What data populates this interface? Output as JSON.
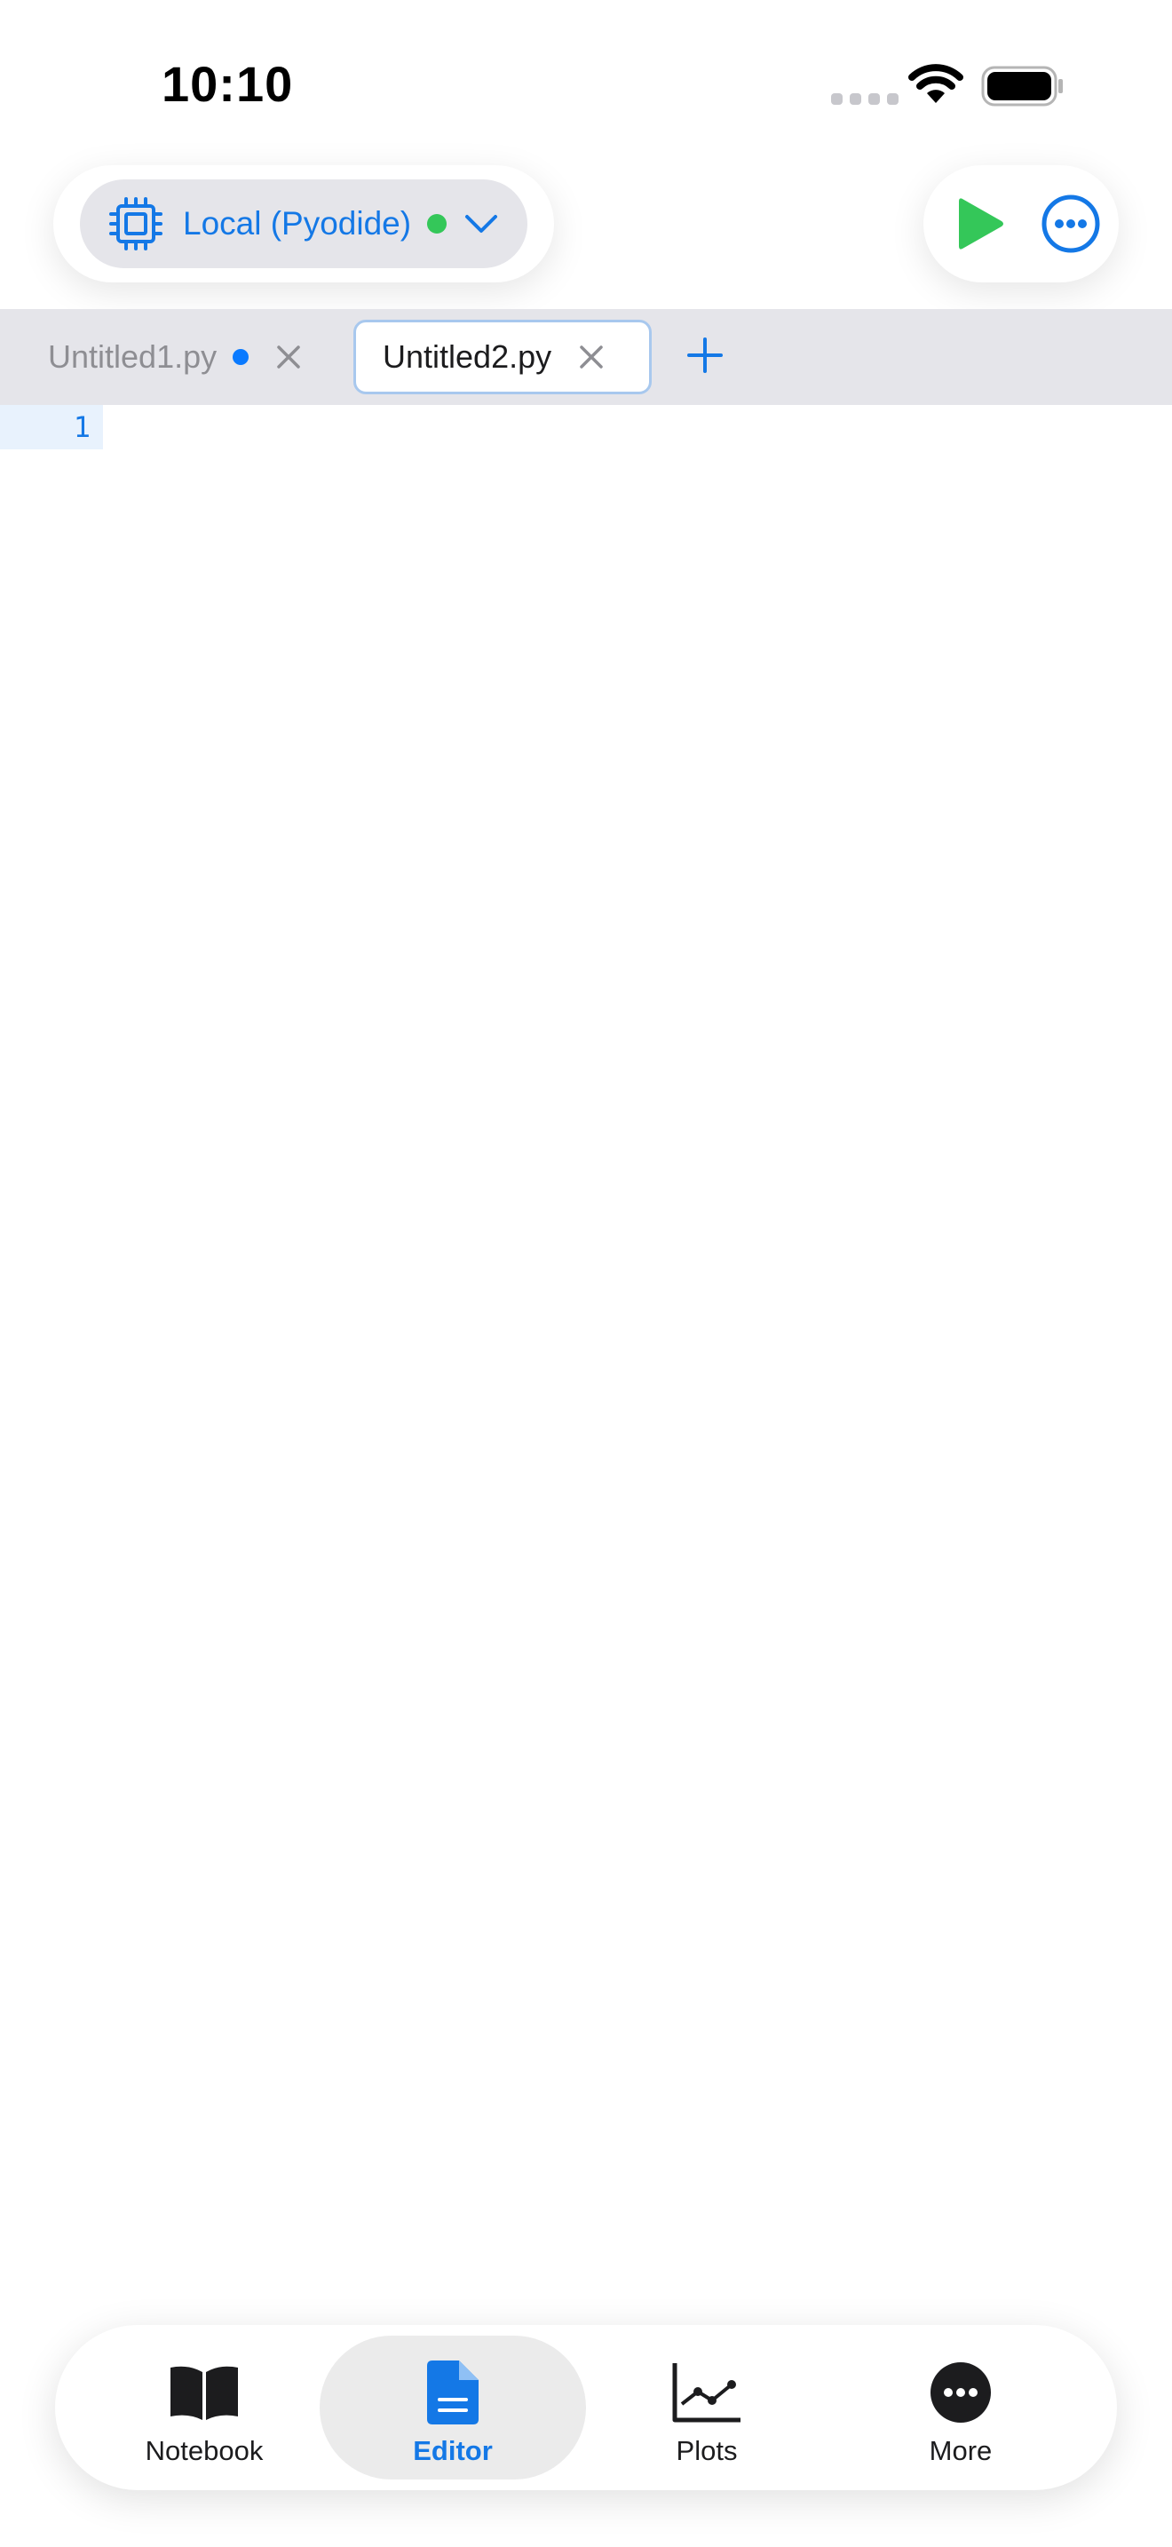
{
  "status_bar": {
    "time": "10:10"
  },
  "runtime": {
    "label": "Local (Pyodide)",
    "status": "connected",
    "status_color": "#34c759",
    "icon": "cpu-chip-icon"
  },
  "actions": {
    "run_icon": "play-icon",
    "more_icon": "ellipsis-circle-icon"
  },
  "tabs": [
    {
      "label": "Untitled1.py",
      "unsaved": true,
      "active": false
    },
    {
      "label": "Untitled2.py",
      "unsaved": false,
      "active": true
    }
  ],
  "editor": {
    "line_numbers": [
      "1"
    ]
  },
  "bottom_nav": {
    "items": [
      {
        "label": "Notebook",
        "icon": "book-icon",
        "active": false
      },
      {
        "label": "Editor",
        "icon": "document-icon",
        "active": true
      },
      {
        "label": "Plots",
        "icon": "line-chart-icon",
        "active": false
      },
      {
        "label": "More",
        "icon": "ellipsis-circle-icon",
        "active": false
      }
    ]
  },
  "colors": {
    "accent": "#1478e6",
    "run": "#34c759",
    "tabbar_bg": "#e5e5ea",
    "unsaved_dot": "#0a7aff"
  }
}
